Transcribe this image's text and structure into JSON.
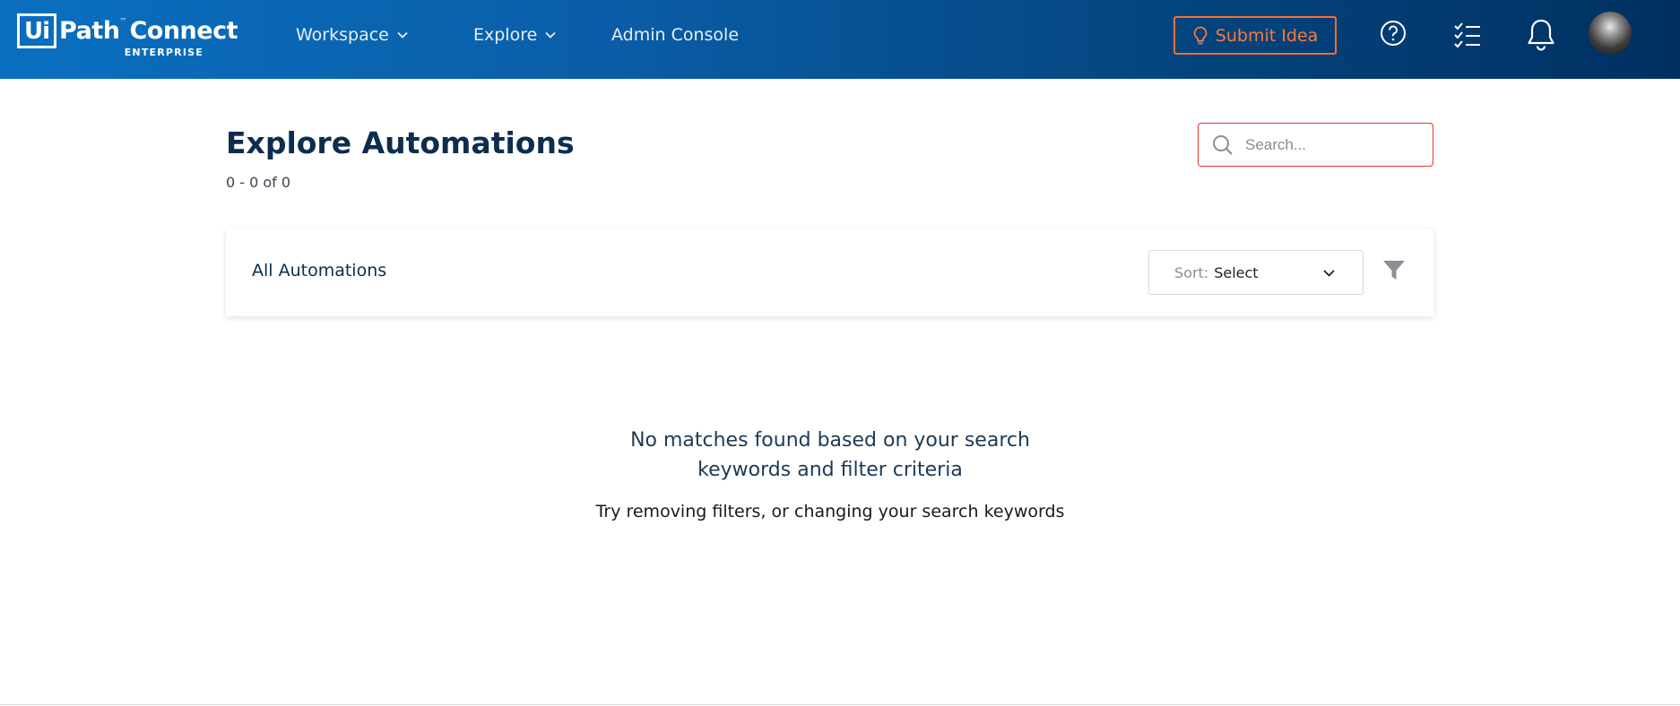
{
  "header": {
    "logo": {
      "mark": "Ui",
      "name_part": "Path",
      "tm": "™",
      "product": "Connect",
      "subtitle": "ENTERPRISE"
    },
    "nav": [
      {
        "label": "Workspace",
        "icon": "chevron-down-icon"
      },
      {
        "label": "Explore",
        "icon": "chevron-down-icon"
      },
      {
        "label": "Admin Console"
      }
    ],
    "submit_idea": {
      "label": "Submit Idea",
      "icon": "lightbulb-icon"
    },
    "icons": [
      "help-icon",
      "tasks-icon",
      "bell-icon",
      "avatar"
    ]
  },
  "main": {
    "title": "Explore Automations",
    "count": "0 - 0 of 0",
    "search": {
      "placeholder": "Search...",
      "value": ""
    },
    "panel": {
      "title": "All Automations",
      "sort": {
        "label": "Sort:",
        "value": "Select"
      },
      "filter_icon": "filter-icon"
    },
    "empty": {
      "line1": "No matches found based on your search",
      "line2": "keywords and filter criteria",
      "hint": "Try removing filters, or changing your search keywords"
    }
  },
  "colors": {
    "header_start": "#0a6fc0",
    "header_end": "#003061",
    "accent_orange": "#fa6f2b",
    "search_border": "#e8332a",
    "title": "#0d2d4e"
  }
}
